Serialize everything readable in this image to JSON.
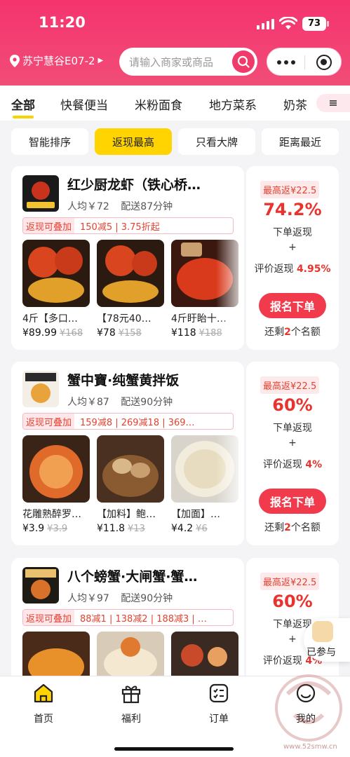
{
  "status": {
    "time": "11:20",
    "battery": "73"
  },
  "header": {
    "location": "苏宁慧谷E07-2",
    "search_placeholder": "请输入商家或商品"
  },
  "categories": [
    "全部",
    "快餐便当",
    "米粉面食",
    "地方菜系",
    "奶茶"
  ],
  "filters": [
    "智能排序",
    "返现最高",
    "只看大牌",
    "距离最近"
  ],
  "stores": [
    {
      "name": "红少厨龙虾（铁心桥…",
      "avg": "人均￥72",
      "delivery": "配送87分钟",
      "promo_tag": "返现可叠加",
      "promo_text": "150减5 | 3.75折起",
      "dishes": [
        {
          "name": "4斤【多口…",
          "price": "¥89.99",
          "orig": "¥168"
        },
        {
          "name": "【78元40…",
          "price": "¥78",
          "orig": "¥158"
        },
        {
          "name": "4斤盱眙十…",
          "price": "¥118",
          "orig": "¥188"
        }
      ],
      "max_rebate": "最高返¥22.5",
      "percent": "74.2%",
      "order_rebate": "下单返现",
      "plus": "+",
      "review_label": "评价返现",
      "review_pct": "4.95%",
      "button": "报名下单",
      "remain_pre": "还剩",
      "remain_num": "2",
      "remain_post": "个名额"
    },
    {
      "name": "蟹中寶·纯蟹黄拌饭",
      "avg": "人均￥87",
      "delivery": "配送90分钟",
      "promo_tag": "返现可叠加",
      "promo_text": "159减8 | 269减18 | 369…",
      "dishes": [
        {
          "name": "花雕熟醉罗…",
          "price": "¥3.9",
          "orig": "¥3.9"
        },
        {
          "name": "【加料】鲍…",
          "price": "¥11.8",
          "orig": "¥13"
        },
        {
          "name": "【加面】…",
          "price": "¥4.2",
          "orig": "¥6"
        }
      ],
      "max_rebate": "最高返¥22.5",
      "percent": "60%",
      "order_rebate": "下单返现",
      "plus": "+",
      "review_label": "评价返现",
      "review_pct": "4%",
      "button": "报名下单",
      "remain_pre": "还剩",
      "remain_num": "2",
      "remain_post": "个名额"
    },
    {
      "name": "八个螃蟹·大闸蟹·蟹…",
      "avg": "人均￥97",
      "delivery": "配送90分钟",
      "promo_tag": "返现可叠加",
      "promo_text": "88减1 | 138减2 | 188减3 | …",
      "max_rebate": "最高返¥22.5",
      "percent": "60%",
      "order_rebate": "下单返现",
      "plus": "+",
      "review_label": "评价返现",
      "review_pct": "4%"
    }
  ],
  "floating": {
    "joined": "已参与"
  },
  "nav": [
    "首页",
    "福利",
    "订单",
    "我的"
  ],
  "watermark": "www.52smw.cn",
  "colors": {
    "brand": "#f5336e",
    "accent": "#ffd400",
    "price_red": "#e8332f"
  }
}
